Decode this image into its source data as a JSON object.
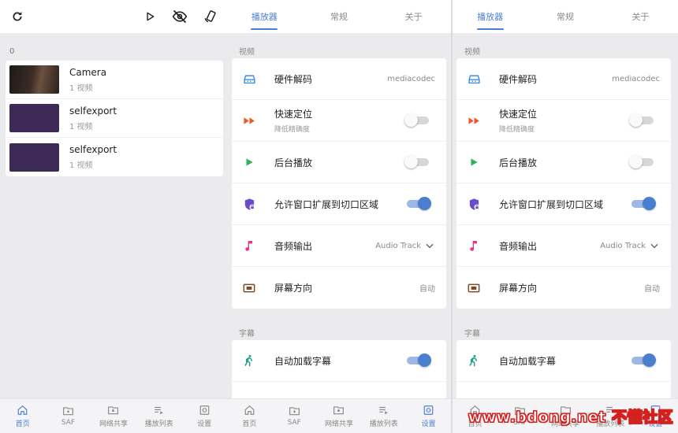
{
  "colors": {
    "accent": "#4a7fd0",
    "background": "#ebebed",
    "card": "#ffffff"
  },
  "library": {
    "toolbar_icons": [
      "refresh-icon",
      "play-icon",
      "eye-off-icon",
      "rotate-screen-icon"
    ],
    "count": "0",
    "items": [
      {
        "name": "Camera",
        "sub": "1 视频"
      },
      {
        "name": "selfexport",
        "sub": "1 视频"
      },
      {
        "name": "selfexport",
        "sub": "1 视频"
      }
    ]
  },
  "settings": {
    "tabs": [
      "播放器",
      "常规",
      "关于"
    ],
    "active_tab": 0,
    "video_section": "视频",
    "subtitle_section": "字幕",
    "rows": {
      "hwdec": {
        "title": "硬件解码",
        "value": "mediacodec"
      },
      "fast_seek": {
        "title": "快速定位",
        "sub": "降低精确度",
        "on": false
      },
      "background_play": {
        "title": "后台播放",
        "on": false
      },
      "cutout": {
        "title": "允许窗口扩展到切口区域",
        "on": true
      },
      "audio_output": {
        "title": "音频输出",
        "value": "Audio Track"
      },
      "orientation": {
        "title": "屏幕方向",
        "value": "自动"
      },
      "auto_subtitle": {
        "title": "自动加载字幕",
        "on": true
      }
    }
  },
  "nav": [
    {
      "label": "首页",
      "icon": "home-icon"
    },
    {
      "label": "SAF",
      "icon": "folder-icon"
    },
    {
      "label": "网络共享",
      "icon": "network-share-icon"
    },
    {
      "label": "播放列表",
      "icon": "playlist-icon"
    },
    {
      "label": "设置",
      "icon": "settings-icon"
    }
  ],
  "watermark": "www.bdong.net 不懂社区"
}
